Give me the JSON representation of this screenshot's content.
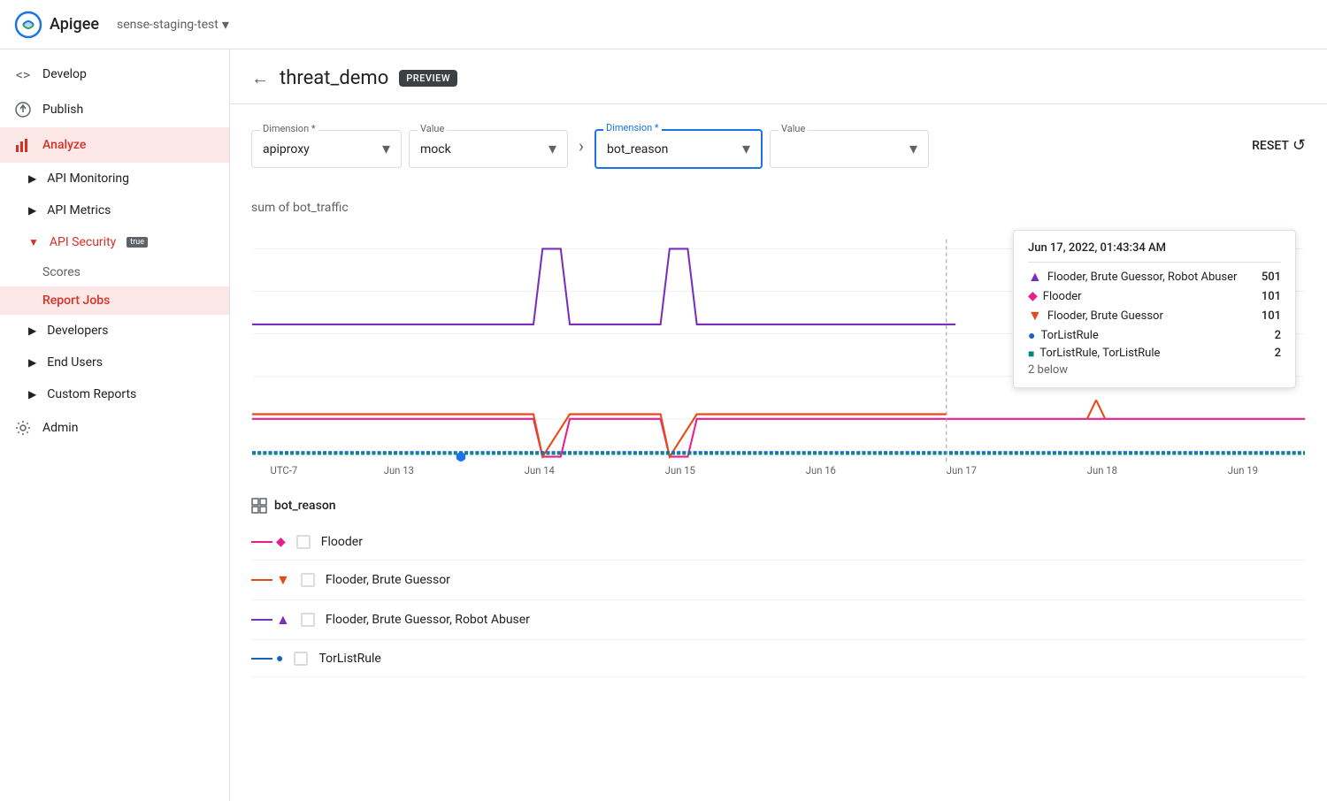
{
  "topbar": {
    "logo_text": "Apigee",
    "org": "sense-staging-test"
  },
  "sidebar": {
    "items": [
      {
        "id": "develop",
        "label": "Develop",
        "icon": "<>",
        "active": false
      },
      {
        "id": "publish",
        "label": "Publish",
        "icon": "↑",
        "active": false
      },
      {
        "id": "analyze",
        "label": "Analyze",
        "icon": "📊",
        "active": true
      },
      {
        "id": "admin",
        "label": "Admin",
        "icon": "⚙",
        "active": false
      }
    ],
    "analyze_children": [
      {
        "id": "api-monitoring",
        "label": "API Monitoring",
        "active": false
      },
      {
        "id": "api-metrics",
        "label": "API Metrics",
        "active": false
      },
      {
        "id": "api-security",
        "label": "API Security",
        "preview": true,
        "active": true,
        "expanded": true,
        "children": [
          {
            "id": "scores",
            "label": "Scores",
            "active": false
          },
          {
            "id": "report-jobs",
            "label": "Report Jobs",
            "active": true
          }
        ]
      },
      {
        "id": "developers",
        "label": "Developers",
        "active": false
      },
      {
        "id": "end-users",
        "label": "End Users",
        "active": false
      },
      {
        "id": "custom-reports",
        "label": "Custom Reports",
        "active": false
      }
    ]
  },
  "page": {
    "back_label": "←",
    "title": "threat_demo",
    "preview_badge": "PREVIEW"
  },
  "filter_bar": {
    "dim1_label": "Dimension *",
    "dim1_value": "apiproxy",
    "val1_label": "Value",
    "val1_value": "mock",
    "dim2_label": "Dimension *",
    "dim2_value": "bot_reason",
    "val2_label": "Value",
    "val2_value": "",
    "reset_label": "RESET"
  },
  "chart": {
    "title": "sum of bot_traffic",
    "x_labels": [
      "UTC-7",
      "Jun 13",
      "Jun 14",
      "Jun 15",
      "Jun 16",
      "Jun 17",
      "Jun 18",
      "Jun 19"
    ],
    "cursor_date": "Jun 17",
    "tooltip": {
      "date": "Jun 17, 2022, 01:43:34 AM",
      "dash": "–",
      "rows": [
        {
          "label": "Flooder, Brute Guessor, Robot Abuser",
          "value": "501",
          "color": "#7b2dbe",
          "marker": "triangle-up"
        },
        {
          "label": "Flooder",
          "value": "101",
          "color": "#e91e8c",
          "marker": "diamond"
        },
        {
          "label": "Flooder, Brute Guessor",
          "value": "101",
          "color": "#e64a19",
          "marker": "triangle-down"
        },
        {
          "label": "TorListRule",
          "value": "2",
          "color": "#1565c0",
          "marker": "dot"
        },
        {
          "label": "TorListRule, TorListRule",
          "value": "2",
          "color": "#00897b",
          "marker": "square"
        }
      ],
      "below": "2 below"
    }
  },
  "legend": {
    "title": "bot_reason",
    "items": [
      {
        "label": "Flooder",
        "color": "#e91e8c",
        "marker": "diamond"
      },
      {
        "label": "Flooder, Brute Guessor",
        "color": "#e64a19",
        "marker": "triangle-down"
      },
      {
        "label": "Flooder, Brute Guessor, Robot Abuser",
        "color": "#7b2dbe",
        "marker": "triangle-up"
      },
      {
        "label": "TorListRule",
        "color": "#1565c0",
        "marker": "dot"
      }
    ]
  }
}
